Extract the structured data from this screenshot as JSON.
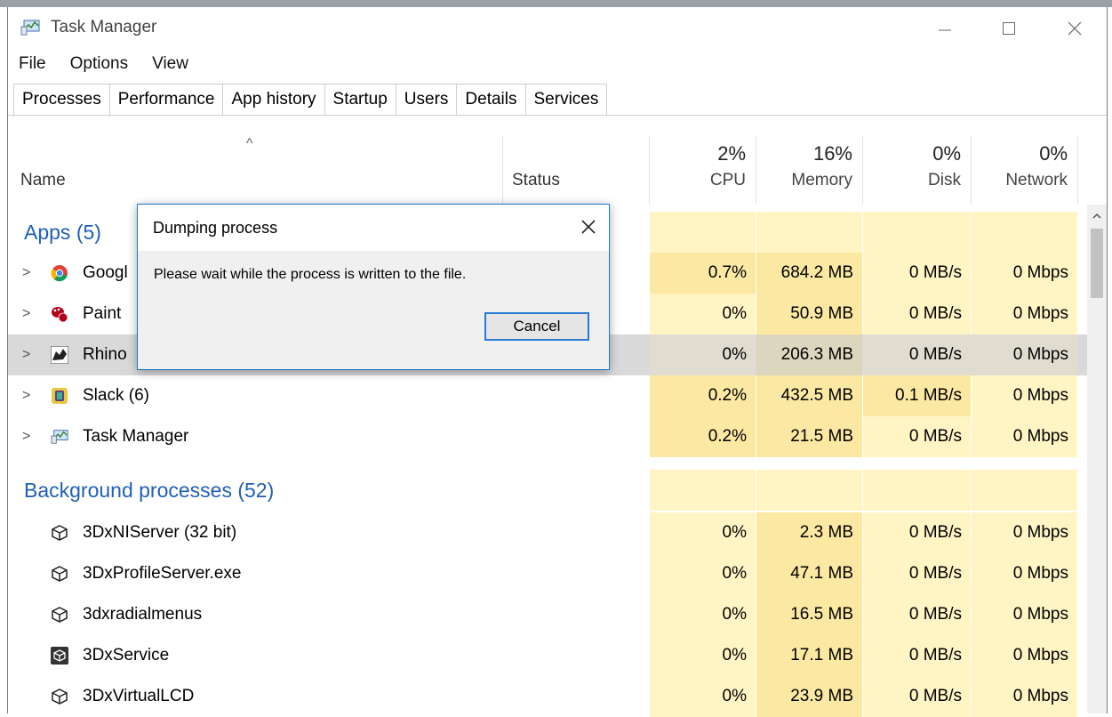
{
  "window": {
    "title": "Task Manager"
  },
  "menu": [
    "File",
    "Options",
    "View"
  ],
  "tabs": [
    "Processes",
    "Performance",
    "App history",
    "Startup",
    "Users",
    "Details",
    "Services"
  ],
  "header": {
    "name": "Name",
    "status": "Status",
    "cpu_pct": "2%",
    "cpu_label": "CPU",
    "mem_pct": "16%",
    "mem_label": "Memory",
    "disk_pct": "0%",
    "disk_label": "Disk",
    "net_pct": "0%",
    "net_label": "Network"
  },
  "groups": {
    "apps": "Apps (5)",
    "background": "Background processes (52)"
  },
  "apps": [
    {
      "name": "Googl",
      "cpu": "0.7%",
      "memory": "684.2 MB",
      "disk": "0 MB/s",
      "network": "0 Mbps",
      "icon": "chrome-icon"
    },
    {
      "name": "Paint",
      "cpu": "0%",
      "memory": "50.9 MB",
      "disk": "0 MB/s",
      "network": "0 Mbps",
      "icon": "paint-icon"
    },
    {
      "name": "Rhino",
      "cpu": "0%",
      "memory": "206.3 MB",
      "disk": "0 MB/s",
      "network": "0 Mbps",
      "icon": "rhino-icon"
    },
    {
      "name": "Slack (6)",
      "cpu": "0.2%",
      "memory": "432.5 MB",
      "disk": "0.1 MB/s",
      "network": "0 Mbps",
      "icon": "slack-icon"
    },
    {
      "name": "Task Manager",
      "cpu": "0.2%",
      "memory": "21.5 MB",
      "disk": "0 MB/s",
      "network": "0 Mbps",
      "icon": "task-manager-icon"
    }
  ],
  "background": [
    {
      "name": "3DxNIServer (32 bit)",
      "cpu": "0%",
      "memory": "2.3 MB",
      "disk": "0 MB/s",
      "network": "0 Mbps"
    },
    {
      "name": "3DxProfileServer.exe",
      "cpu": "0%",
      "memory": "47.1 MB",
      "disk": "0 MB/s",
      "network": "0 Mbps"
    },
    {
      "name": "3dxradialmenus",
      "cpu": "0%",
      "memory": "16.5 MB",
      "disk": "0 MB/s",
      "network": "0 Mbps"
    },
    {
      "name": "3DxService",
      "cpu": "0%",
      "memory": "17.1 MB",
      "disk": "0 MB/s",
      "network": "0 Mbps"
    },
    {
      "name": "3DxVirtualLCD",
      "cpu": "0%",
      "memory": "23.9 MB",
      "disk": "0 MB/s",
      "network": "0 Mbps"
    }
  ],
  "dialog": {
    "title": "Dumping process",
    "message": "Please wait while the process is written to the file.",
    "cancel": "Cancel"
  }
}
